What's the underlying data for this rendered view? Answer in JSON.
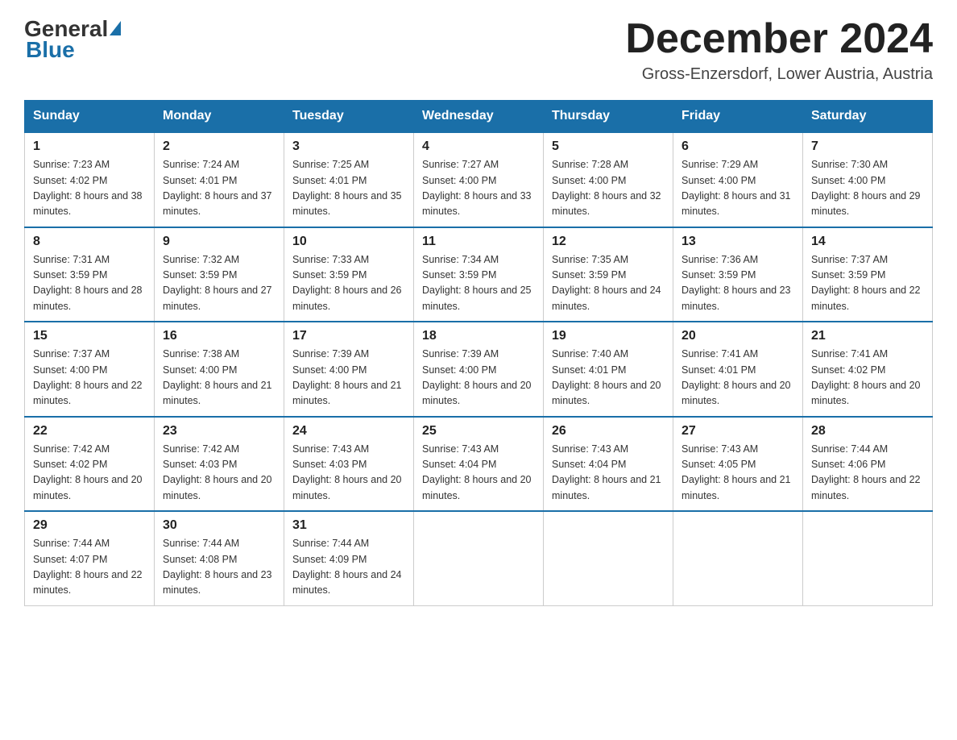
{
  "header": {
    "logo_general": "General",
    "logo_blue": "Blue",
    "month_title": "December 2024",
    "location": "Gross-Enzersdorf, Lower Austria, Austria"
  },
  "columns": [
    "Sunday",
    "Monday",
    "Tuesday",
    "Wednesday",
    "Thursday",
    "Friday",
    "Saturday"
  ],
  "weeks": [
    [
      {
        "day": "1",
        "sunrise": "7:23 AM",
        "sunset": "4:02 PM",
        "daylight": "8 hours and 38 minutes."
      },
      {
        "day": "2",
        "sunrise": "7:24 AM",
        "sunset": "4:01 PM",
        "daylight": "8 hours and 37 minutes."
      },
      {
        "day": "3",
        "sunrise": "7:25 AM",
        "sunset": "4:01 PM",
        "daylight": "8 hours and 35 minutes."
      },
      {
        "day": "4",
        "sunrise": "7:27 AM",
        "sunset": "4:00 PM",
        "daylight": "8 hours and 33 minutes."
      },
      {
        "day": "5",
        "sunrise": "7:28 AM",
        "sunset": "4:00 PM",
        "daylight": "8 hours and 32 minutes."
      },
      {
        "day": "6",
        "sunrise": "7:29 AM",
        "sunset": "4:00 PM",
        "daylight": "8 hours and 31 minutes."
      },
      {
        "day": "7",
        "sunrise": "7:30 AM",
        "sunset": "4:00 PM",
        "daylight": "8 hours and 29 minutes."
      }
    ],
    [
      {
        "day": "8",
        "sunrise": "7:31 AM",
        "sunset": "3:59 PM",
        "daylight": "8 hours and 28 minutes."
      },
      {
        "day": "9",
        "sunrise": "7:32 AM",
        "sunset": "3:59 PM",
        "daylight": "8 hours and 27 minutes."
      },
      {
        "day": "10",
        "sunrise": "7:33 AM",
        "sunset": "3:59 PM",
        "daylight": "8 hours and 26 minutes."
      },
      {
        "day": "11",
        "sunrise": "7:34 AM",
        "sunset": "3:59 PM",
        "daylight": "8 hours and 25 minutes."
      },
      {
        "day": "12",
        "sunrise": "7:35 AM",
        "sunset": "3:59 PM",
        "daylight": "8 hours and 24 minutes."
      },
      {
        "day": "13",
        "sunrise": "7:36 AM",
        "sunset": "3:59 PM",
        "daylight": "8 hours and 23 minutes."
      },
      {
        "day": "14",
        "sunrise": "7:37 AM",
        "sunset": "3:59 PM",
        "daylight": "8 hours and 22 minutes."
      }
    ],
    [
      {
        "day": "15",
        "sunrise": "7:37 AM",
        "sunset": "4:00 PM",
        "daylight": "8 hours and 22 minutes."
      },
      {
        "day": "16",
        "sunrise": "7:38 AM",
        "sunset": "4:00 PM",
        "daylight": "8 hours and 21 minutes."
      },
      {
        "day": "17",
        "sunrise": "7:39 AM",
        "sunset": "4:00 PM",
        "daylight": "8 hours and 21 minutes."
      },
      {
        "day": "18",
        "sunrise": "7:39 AM",
        "sunset": "4:00 PM",
        "daylight": "8 hours and 20 minutes."
      },
      {
        "day": "19",
        "sunrise": "7:40 AM",
        "sunset": "4:01 PM",
        "daylight": "8 hours and 20 minutes."
      },
      {
        "day": "20",
        "sunrise": "7:41 AM",
        "sunset": "4:01 PM",
        "daylight": "8 hours and 20 minutes."
      },
      {
        "day": "21",
        "sunrise": "7:41 AM",
        "sunset": "4:02 PM",
        "daylight": "8 hours and 20 minutes."
      }
    ],
    [
      {
        "day": "22",
        "sunrise": "7:42 AM",
        "sunset": "4:02 PM",
        "daylight": "8 hours and 20 minutes."
      },
      {
        "day": "23",
        "sunrise": "7:42 AM",
        "sunset": "4:03 PM",
        "daylight": "8 hours and 20 minutes."
      },
      {
        "day": "24",
        "sunrise": "7:43 AM",
        "sunset": "4:03 PM",
        "daylight": "8 hours and 20 minutes."
      },
      {
        "day": "25",
        "sunrise": "7:43 AM",
        "sunset": "4:04 PM",
        "daylight": "8 hours and 20 minutes."
      },
      {
        "day": "26",
        "sunrise": "7:43 AM",
        "sunset": "4:04 PM",
        "daylight": "8 hours and 21 minutes."
      },
      {
        "day": "27",
        "sunrise": "7:43 AM",
        "sunset": "4:05 PM",
        "daylight": "8 hours and 21 minutes."
      },
      {
        "day": "28",
        "sunrise": "7:44 AM",
        "sunset": "4:06 PM",
        "daylight": "8 hours and 22 minutes."
      }
    ],
    [
      {
        "day": "29",
        "sunrise": "7:44 AM",
        "sunset": "4:07 PM",
        "daylight": "8 hours and 22 minutes."
      },
      {
        "day": "30",
        "sunrise": "7:44 AM",
        "sunset": "4:08 PM",
        "daylight": "8 hours and 23 minutes."
      },
      {
        "day": "31",
        "sunrise": "7:44 AM",
        "sunset": "4:09 PM",
        "daylight": "8 hours and 24 minutes."
      },
      null,
      null,
      null,
      null
    ]
  ]
}
